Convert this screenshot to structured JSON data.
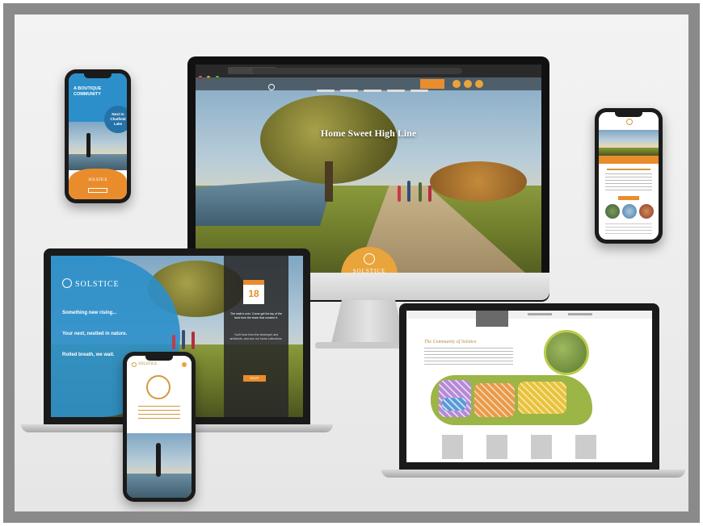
{
  "imac": {
    "hero_title": "Home Sweet High Line",
    "badge_logo": "SOLSTICE"
  },
  "phone_left": {
    "headline": "A BOUTIQUE COMMUNITY",
    "circle_text": "Next to Chatfield Lake",
    "logo": "SOLSTICE"
  },
  "laptop_left": {
    "logo": "SOLSTICE",
    "line1": "Something new rising...",
    "line2": "Your next, nestled in nature.",
    "line3": "Rolled breath, we wait.",
    "calendar_day": "18",
    "panel_text_1": "The wait is over. Come get the lay of the land from the team that created it.",
    "panel_text_2": "You'll hear from the developer and architects, and see our home collections.",
    "panel_button": "RSVP"
  },
  "phone_front": {
    "logo": "SOLSTICE"
  },
  "laptop_right": {
    "title": "The Community of Solstice"
  },
  "colors": {
    "accent_orange": "#e98d2c",
    "accent_blue": "#2c8fc9",
    "gold": "#e9a43b",
    "frame_gray": "#8a8a8a"
  }
}
